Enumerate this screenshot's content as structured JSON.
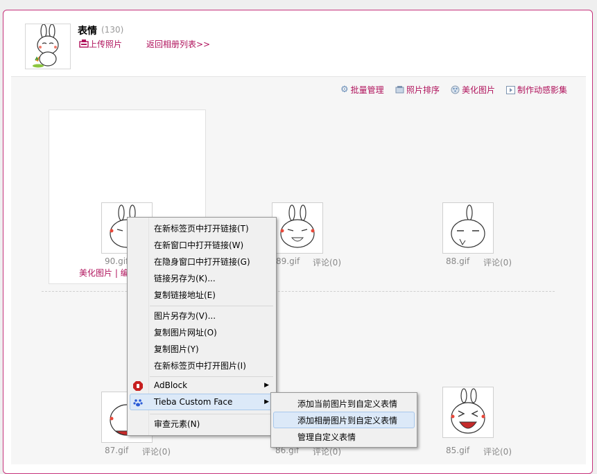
{
  "album": {
    "title": "表情",
    "count": "(130)",
    "upload_label": "上传照片",
    "back_label": "返回相册列表>>"
  },
  "toolbar": {
    "batch": "批量管理",
    "sort": "照片排序",
    "beautify": "美化图片",
    "slideshow": "制作动感影集"
  },
  "photos": [
    {
      "name": "90.gif",
      "comment": ""
    },
    {
      "name": "89.gif",
      "comment": "评论(0)"
    },
    {
      "name": "88.gif",
      "comment": "评论(0)"
    },
    {
      "name": "87.gif",
      "comment": "评论(0)"
    },
    {
      "name": "86.gif",
      "comment": "评论(0)"
    },
    {
      "name": "85.gif",
      "comment": "评论(0)"
    }
  ],
  "photo_actions": "美化图片 | 编",
  "context_menu": {
    "items": [
      "在新标签页中打开链接(T)",
      "在新窗口中打开链接(W)",
      "在隐身窗口中打开链接(G)",
      "链接另存为(K)...",
      "复制链接地址(E)",
      "图片另存为(V)...",
      "复制图片网址(O)",
      "复制图片(Y)",
      "在新标签页中打开图片(I)",
      "AdBlock",
      "Tieba Custom Face",
      "审查元素(N)"
    ]
  },
  "submenu": {
    "items": [
      "添加当前图片到自定义表情",
      "添加相册图片到自定义表情",
      "管理自定义表情"
    ]
  },
  "colors": {
    "accent": "#b0135c",
    "frame": "#c5317a"
  }
}
